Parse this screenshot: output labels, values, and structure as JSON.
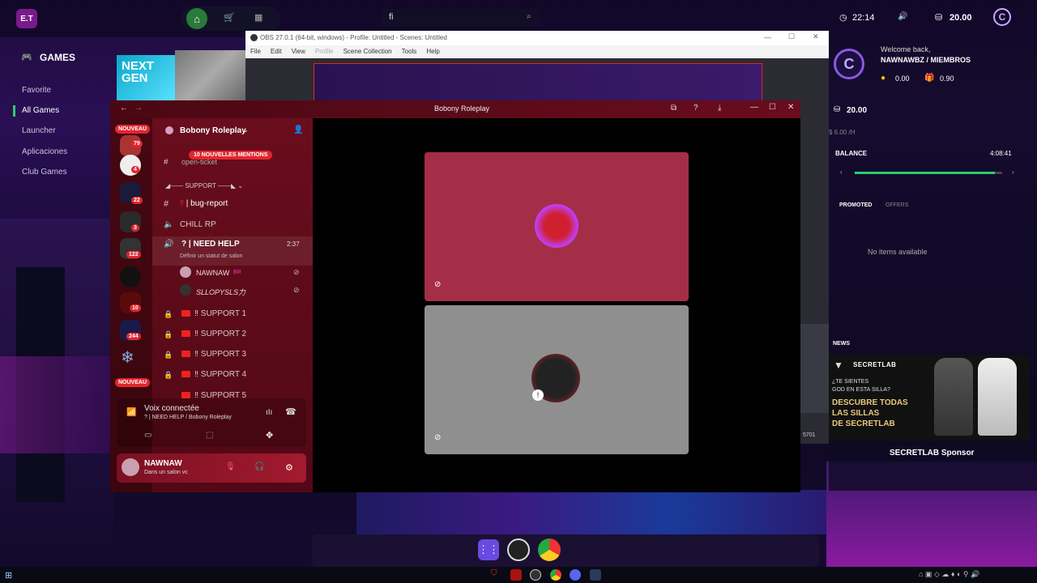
{
  "topbar": {
    "search_value": "fi",
    "clock": "22:14",
    "coins": "20.00"
  },
  "nav": {
    "section": "GAMES",
    "items": [
      "Favorite",
      "All Games",
      "Launcher",
      "Aplicaciones",
      "Club Games"
    ],
    "banner": "NEXT GEN"
  },
  "obs": {
    "title": "OBS 27.0.1 (64-bit, windows) - Profile: Untitled - Scenes: Untitled",
    "menu": [
      "File",
      "Edit",
      "View",
      "Profile",
      "Scene Collection",
      "Tools",
      "Help"
    ],
    "status": "5701"
  },
  "discord": {
    "window_title": "Bobony Roleplay",
    "server_name": "Bobony Roleplay",
    "mentions": "10 NOUVELLES MENTIONS",
    "new_label": "NOUVEAU",
    "server_badges": [
      "79",
      "4",
      "22",
      "3",
      "122",
      "10",
      "244"
    ],
    "category": "SUPPORT",
    "channels": {
      "hidden": "open-ticket",
      "bug": "bug-report",
      "chill": "CHILL RP",
      "help": "? | NEED HELP",
      "help_time": "2:37",
      "status_hint": "Définir un statut de salon"
    },
    "voice_users": [
      {
        "name": "NAWNAW",
        "tag": "BR"
      },
      {
        "name": "SLLOPYSLS力",
        "tag": ""
      }
    ],
    "locked": [
      "‼ SUPPORT 1",
      "‼ SUPPORT 2",
      "‼ SUPPORT 3",
      "‼ SUPPORT 4",
      "‼ SUPPORT 5"
    ],
    "voice": {
      "status": "Voix connectée",
      "channel": "? | NEED HELP / Bobony Roleplay"
    },
    "user": {
      "name": "NAWNAW",
      "status": "Dans un salon vc"
    }
  },
  "right": {
    "welcome": "Welcome back,",
    "user": "NAWNAWBZ / MIEMBROS",
    "stat1": "0.00",
    "stat2": "0.90",
    "coins": "20.00",
    "rate": "$ 6.00 /H",
    "balance_label": "BALANCE",
    "balance_time": "4:08:41",
    "balance_progress": 0.95,
    "tabs": [
      "PROMOTED",
      "OFFERS"
    ],
    "empty": "No items available",
    "news_label": "NEWS",
    "ad": {
      "brand": "SECRETLAB",
      "q1": "¿TE SIENTES",
      "q2": "GOD EN ESTA SILLA?",
      "c1": "DESCUBRE TODAS",
      "c2": "LAS SILLAS",
      "c3": "DE SECRETLAB"
    },
    "sponsor": "SECRETLAB Sponsor"
  },
  "colors": {
    "accent": "#2ecc71",
    "discord_red": "#6a0c1e",
    "card_red": "#a42e47"
  }
}
